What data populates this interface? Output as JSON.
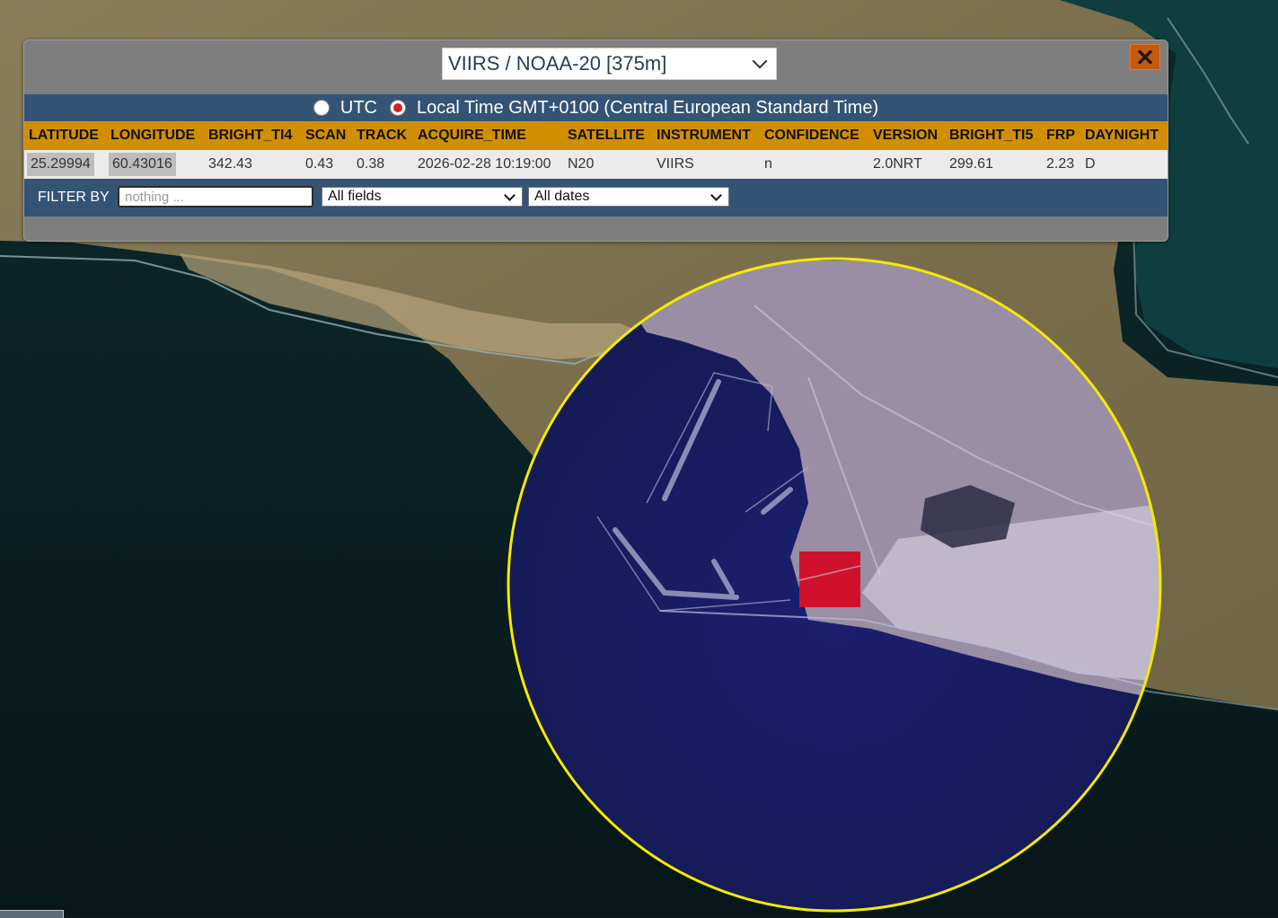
{
  "map": {
    "highlight_ring_color": "#f5ea00",
    "fire_pixel_color": "#d0112b",
    "overlay_tint": "#1b1f7a"
  },
  "panel": {
    "source_select": {
      "value": "VIIRS / NOAA-20 [375m]"
    },
    "close_label": "✕",
    "time_options": [
      {
        "label": "UTC",
        "checked": false
      },
      {
        "label": "Local Time GMT+0100 (Central European Standard Time)",
        "checked": true
      }
    ],
    "columns": [
      "LATITUDE",
      "LONGITUDE",
      "BRIGHT_TI4",
      "SCAN",
      "TRACK",
      "ACQUIRE_TIME",
      "SATELLITE",
      "INSTRUMENT",
      "CONFIDENCE",
      "VERSION",
      "BRIGHT_TI5",
      "FRP",
      "DAYNIGHT"
    ],
    "rows": [
      [
        "25.29994",
        "60.43016",
        "342.43",
        "0.43",
        "0.38",
        "2026-02-28 10:19:00",
        "N20",
        "VIIRS",
        "n",
        "2.0NRT",
        "299.61",
        "2.23",
        "D"
      ]
    ],
    "filter": {
      "label": "FILTER BY",
      "placeholder": "nothing ...",
      "field_select": "All fields",
      "date_select": "All dates"
    }
  }
}
